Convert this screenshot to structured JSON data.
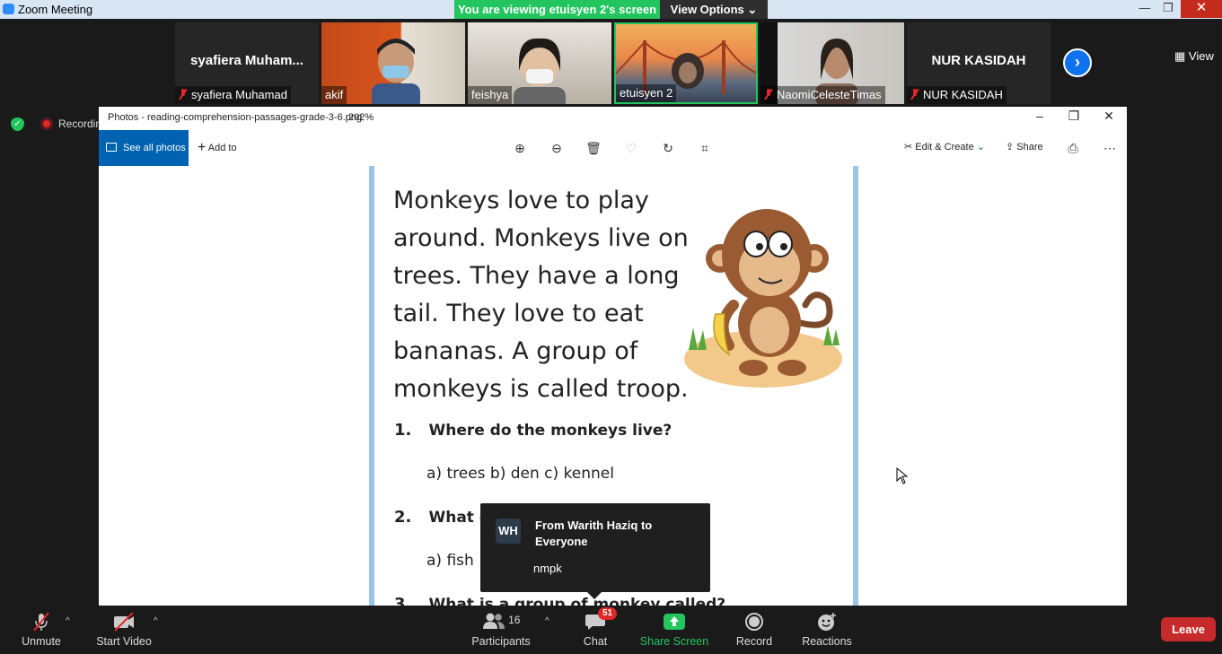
{
  "zoom_window": {
    "title": "Zoom Meeting",
    "share_banner": "You are viewing etuisyen 2's screen",
    "view_options": "View Options"
  },
  "gallery": {
    "tiles": [
      {
        "big_name": "syafiera  Muham...",
        "name": "syafiera Muhamad",
        "muted": true
      },
      {
        "name": "akif",
        "muted": false
      },
      {
        "name": "feishya",
        "muted": false
      },
      {
        "name": "etuisyen 2",
        "muted": false
      },
      {
        "name": "NaomiCelesteTimas",
        "muted": true
      },
      {
        "big_name": "NUR KASIDAH",
        "name": "NUR KASIDAH",
        "muted": true
      }
    ],
    "view_label": "View"
  },
  "recording": {
    "label": "Recording"
  },
  "photos_app": {
    "title": "Photos - reading-comprehension-passages-grade-3-6.png",
    "zoom": "202%",
    "see_all": "See all photos",
    "add_to": "Add to",
    "edit_create": "Edit & Create",
    "share": "Share"
  },
  "document": {
    "paragraph": [
      "Monkeys love to play",
      "around. Monkeys live on",
      "trees. They have a long",
      "tail. They love to eat",
      "bananas. A group of",
      "monkeys is called troop."
    ],
    "q1": {
      "num": "1.",
      "text": "Where do the monkeys live?",
      "answers": "a) trees  b) den  c) kennel"
    },
    "q2": {
      "num": "2.",
      "text": "What d",
      "answers": "a) fish"
    },
    "q3": {
      "num": "3.",
      "text": "What is a group of monkey called?"
    }
  },
  "chat_notification": {
    "initials": "WH",
    "from": "From Warith Haziq to Everyone",
    "message": "nmpk"
  },
  "controls": {
    "unmute": "Unmute",
    "start_video": "Start Video",
    "participants": "Participants",
    "participants_count": "16",
    "chat": "Chat",
    "chat_badge": "51",
    "share_screen": "Share Screen",
    "record": "Record",
    "reactions": "Reactions",
    "leave": "Leave"
  },
  "colors": {
    "share_green": "#23c55e",
    "leave_red": "#c72a2a",
    "photos_blue": "#0063b1",
    "page_border": "#9cc4e6"
  }
}
